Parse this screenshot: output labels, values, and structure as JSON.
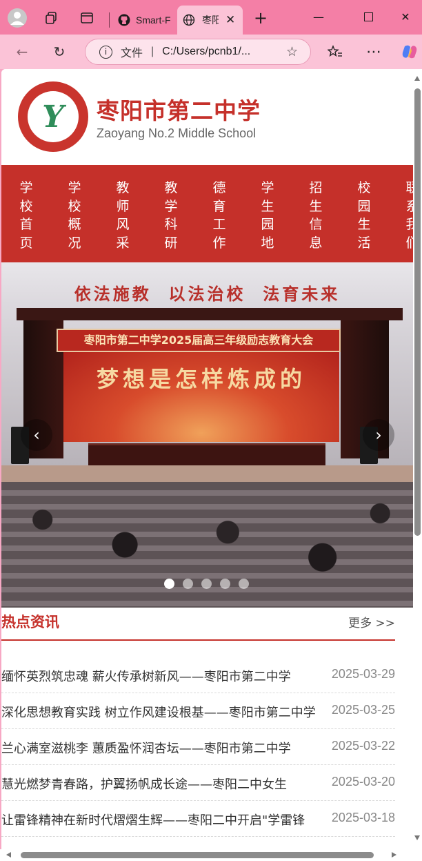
{
  "browser": {
    "tabs": [
      {
        "label": "Smart-F",
        "icon": "github-icon"
      },
      {
        "label": "枣阳",
        "icon": "globe-icon",
        "active": true
      }
    ],
    "address": {
      "security_label": "文件",
      "url": "C:/Users/pcnb1/..."
    },
    "accent": "#f47fa6"
  },
  "site": {
    "title": "枣阳市第二中学",
    "subtitle": "Zaoyang No.2 Middle School",
    "brand_color": "#c5302a"
  },
  "nav": {
    "items": [
      "学校首页",
      "学校概况",
      "教师风采",
      "教学科研",
      "德育工作",
      "学生园地",
      "招生信息",
      "校园生活",
      "联系我们"
    ]
  },
  "carousel": {
    "slogan": "依法施教  以法治校  法育未来",
    "banner": "枣阳市第二中学2025届高三年级励志教育大会",
    "backdrop_title": "梦想是怎样炼成的",
    "prev_label": "‹",
    "next_label": "›",
    "slide_count": 5,
    "active_index": 0
  },
  "news": {
    "title": "热点资讯",
    "more_label": "更多 >>",
    "items": [
      {
        "title": "缅怀英烈筑忠魂 薪火传承树新风——枣阳市第二中学",
        "date": "2025-03-29"
      },
      {
        "title": "深化思想教育实践 树立作风建设根基——枣阳市第二中学",
        "date": "2025-03-25"
      },
      {
        "title": "兰心满室滋桃李 蕙质盈怀润杏坛——枣阳市第二中学",
        "date": "2025-03-22"
      },
      {
        "title": "慧光燃梦青春路，护翼扬帆成长途——枣阳二中女生",
        "date": "2025-03-20"
      },
      {
        "title": "让雷锋精神在新时代熠熠生辉——枣阳二中开启\"学雷锋",
        "date": "2025-03-18"
      }
    ]
  }
}
